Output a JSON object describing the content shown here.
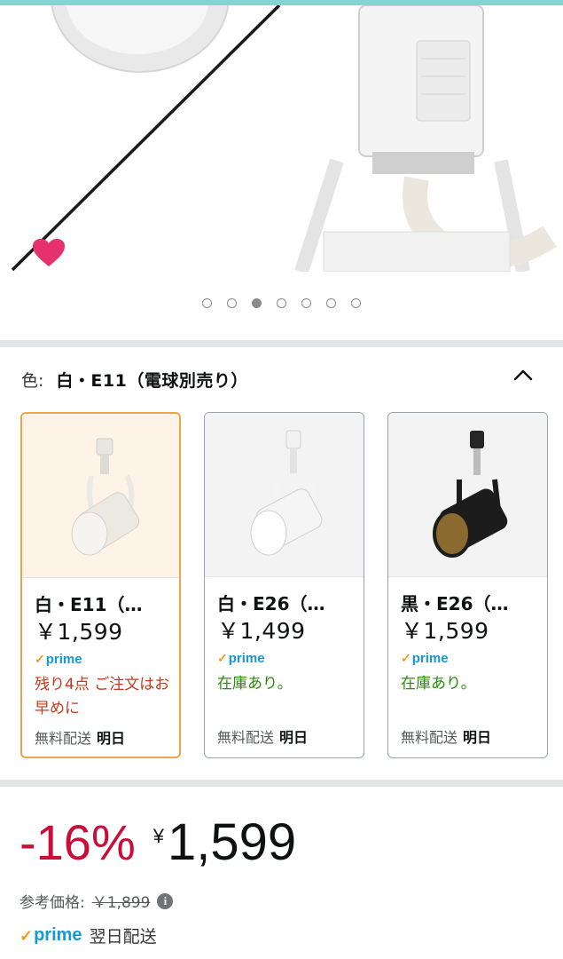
{
  "carousel": {
    "page_count": 7,
    "active_index": 2
  },
  "variant": {
    "label": "色:",
    "selected_value": "白・E11（電球別売り）",
    "options": [
      {
        "name": "白・E11（…",
        "price": "￥1,599",
        "prime": "prime",
        "stock": "残り4点 ご注文はお早めに",
        "stock_status": "low",
        "shipping_label": "無料配送",
        "shipping_day": "明日",
        "selected": true,
        "body_color": "#ece9e2"
      },
      {
        "name": "白・E26（…",
        "price": "￥1,499",
        "prime": "prime",
        "stock": "在庫あり。",
        "stock_status": "in_stock",
        "shipping_label": "無料配送",
        "shipping_day": "明日",
        "selected": false,
        "body_color": "#f5f5f5"
      },
      {
        "name": "黒・E26（…",
        "price": "￥1,599",
        "prime": "prime",
        "stock": "在庫あり。",
        "stock_status": "in_stock",
        "shipping_label": "無料配送",
        "shipping_day": "明日",
        "selected": false,
        "body_color": "#1c1c1c"
      }
    ]
  },
  "price": {
    "discount": "-16%",
    "currency": "¥",
    "amount": "1,599",
    "reference_label": "参考価格:",
    "reference_price": "￥1,899",
    "info_icon": "i"
  },
  "delivery": {
    "prime": "prime",
    "text": "翌日配送"
  },
  "colors": {
    "accent_discount": "#cc0c39",
    "prime_blue": "#1399d6",
    "prime_check": "#f29a1f",
    "selected_border": "#f0a34a",
    "in_stock": "#2a8a0a",
    "low_stock": "#c7391c"
  }
}
